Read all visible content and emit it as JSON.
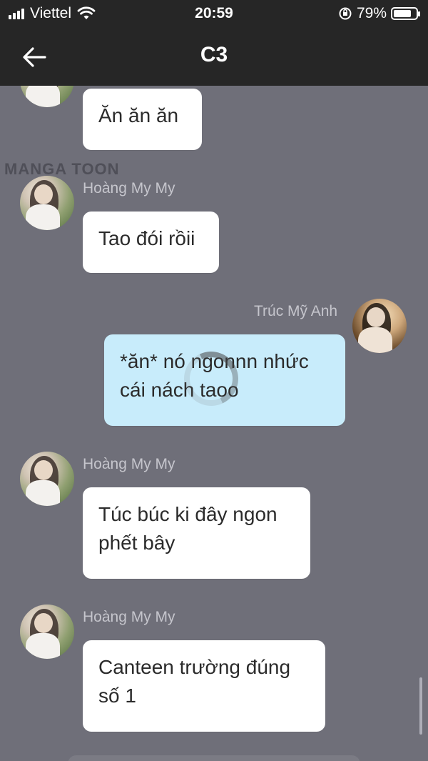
{
  "status_bar": {
    "carrier": "Viettel",
    "time": "20:59",
    "battery_percent": "79%",
    "battery_level": 0.79
  },
  "header": {
    "title": "C3",
    "back_icon": "arrow-left-icon"
  },
  "watermark": "MANGA TOON",
  "messages": [
    {
      "sender": "",
      "text": "Ăn ăn ăn",
      "mine": false
    },
    {
      "sender": "Hoàng My My",
      "text": "Tao đói rồii",
      "mine": false
    },
    {
      "sender": "Trúc Mỹ Anh",
      "text_line1": "*ăn* nó ngonnn nhức",
      "text_line2": "cái nách taoo",
      "mine": true
    },
    {
      "sender": "Hoàng My My",
      "text_line1": "Túc búc ki đây ngon",
      "text_line2": "phết bây",
      "mine": false
    },
    {
      "sender": "Hoàng My My",
      "text_line1": "Canteen trường đúng",
      "text_line2": "số 1",
      "mine": false
    }
  ]
}
